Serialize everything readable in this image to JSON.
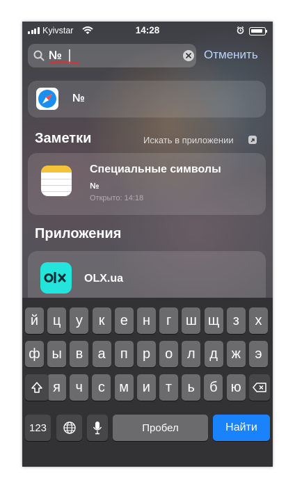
{
  "status": {
    "carrier": "Kyivstar",
    "time": "14:28"
  },
  "search": {
    "query": "№",
    "cancel_label": "Отменить"
  },
  "top_hit": {
    "text": "№"
  },
  "notes_section": {
    "title": "Заметки",
    "search_in_app": "Искать в приложении",
    "note": {
      "title": "Специальные символы",
      "subtitle": "№",
      "opened": "Открыто: 14:18"
    }
  },
  "apps_section": {
    "title": "Приложения",
    "app_name": "OLX.ua"
  },
  "keyboard": {
    "row1": [
      "й",
      "ц",
      "у",
      "к",
      "е",
      "н",
      "г",
      "ш",
      "щ",
      "з",
      "х"
    ],
    "row2": [
      "ф",
      "ы",
      "в",
      "а",
      "п",
      "р",
      "о",
      "л",
      "д",
      "ж",
      "э"
    ],
    "row3": [
      "я",
      "ч",
      "с",
      "м",
      "и",
      "т",
      "ь",
      "б",
      "ю"
    ],
    "numbers_label": "123",
    "space_label": "Пробел",
    "go_label": "Найти"
  },
  "colors": {
    "accent": "#1a82fb",
    "olx": "#23e5db",
    "cancel": "#bcd3ff",
    "highlight": "#d9313a"
  }
}
